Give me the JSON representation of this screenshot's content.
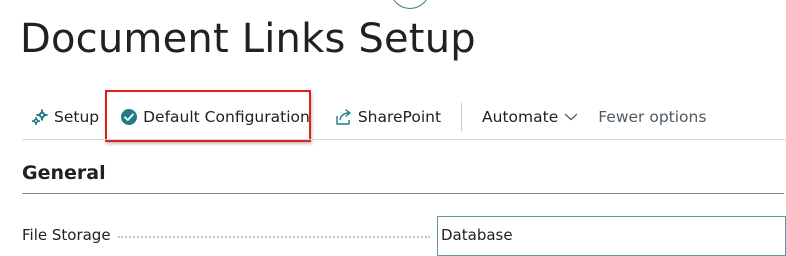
{
  "page": {
    "title": "Document Links Setup"
  },
  "actionbar": {
    "setup_label": "Setup",
    "default_config_label": "Default Configuration",
    "sharepoint_label": "SharePoint",
    "automate_label": "Automate",
    "fewer_options_label": "Fewer options"
  },
  "section": {
    "title": "General"
  },
  "fields": {
    "file_storage": {
      "label": "File Storage",
      "value": "Database"
    }
  },
  "colors": {
    "highlight": "#e01e1e",
    "accent": "#1e7d87",
    "text": "#212121"
  },
  "icons": {
    "setup": "gears-icon",
    "default_config": "check-circle-icon",
    "sharepoint": "share-arrow-icon",
    "automate": "chevron-down-icon"
  }
}
